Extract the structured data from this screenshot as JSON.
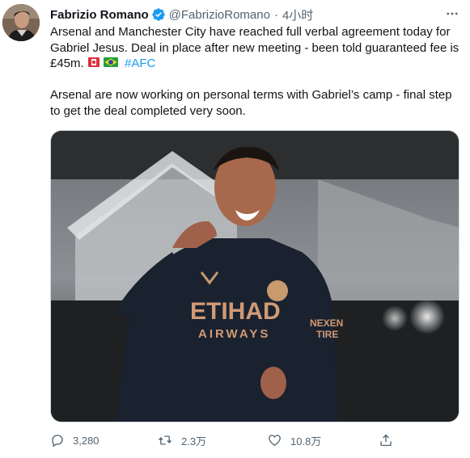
{
  "tweet": {
    "author": {
      "name": "Fabrizio Romano",
      "handle": "@FabrizioRomano",
      "separator": "·",
      "time": "4小时"
    },
    "text_lines": [
      "Arsenal and Manchester City have reached full verbal agreement today for",
      "Gabriel Jesus. Deal in place after new meeting - been told guaranteed fee is",
      "£45m."
    ],
    "hashtag": "#AFC",
    "text_lines_2": [
      "Arsenal are now working on personal terms with Gabriel’s camp - final step",
      "to get the deal completed very soon."
    ],
    "media": {
      "shirt_sponsor_line1": "ETIHAD",
      "shirt_sponsor_line2": "AIRWAYS",
      "sleeve_text_line1": "NEXEN",
      "sleeve_text_line2": "TIRE"
    },
    "actions": {
      "replies": "3,280",
      "retweets": "2.3万",
      "likes": "10.8万"
    }
  },
  "icons": [
    "verified-badge-icon",
    "more-icon",
    "red-flag-emoji-icon",
    "brazil-flag-emoji-icon",
    "reply-icon",
    "retweet-icon",
    "like-icon",
    "share-icon"
  ],
  "colors": {
    "accent": "#1d9bf0",
    "text": "#0f1419",
    "muted": "#536471"
  }
}
